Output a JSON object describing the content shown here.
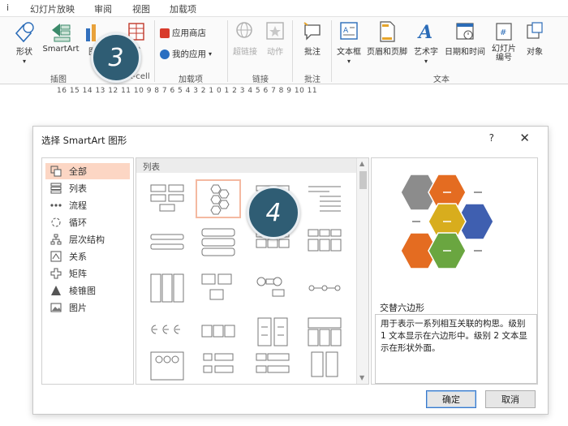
{
  "ribbon": {
    "tabs": [
      "i",
      "幻灯片放映",
      "审阅",
      "视图",
      "加载项"
    ],
    "buttons": {
      "shape": "形状",
      "smartart": "SmartArt",
      "chart": "图",
      "thinkcell": "te",
      "appstore": "应用商店",
      "myapps": "我的应用",
      "hyperlink": "超链接",
      "action": "动作",
      "comment": "批注",
      "textbox": "文本框",
      "headerfooter": "页眉和页脚",
      "wordart": "艺术字",
      "datetime": "日期和时间",
      "slidenumber": "幻灯片\n编号",
      "object": "对象"
    },
    "groups": {
      "illustrations": "插图",
      "thinkcell": "k-cell",
      "addins": "加载项",
      "links": "链接",
      "comments": "批注",
      "text": "文本"
    },
    "ruler": "16 15 14 13 12 11 10 9 8 7 6 5 4 3 2 1 0 1 2 3 4 5 6 7 8 9 10 11"
  },
  "callouts": {
    "step3": "3",
    "step4": "4"
  },
  "dialog": {
    "title": "选择 SmartArt 图形",
    "help": "?",
    "close": "✕",
    "categories": [
      {
        "label": "全部",
        "icon": "all-icon"
      },
      {
        "label": "列表",
        "icon": "list-icon"
      },
      {
        "label": "流程",
        "icon": "process-icon"
      },
      {
        "label": "循环",
        "icon": "cycle-icon"
      },
      {
        "label": "层次结构",
        "icon": "hierarchy-icon"
      },
      {
        "label": "关系",
        "icon": "relationship-icon"
      },
      {
        "label": "矩阵",
        "icon": "matrix-icon"
      },
      {
        "label": "棱锥图",
        "icon": "pyramid-icon"
      },
      {
        "label": "图片",
        "icon": "picture-icon"
      }
    ],
    "selected_category": "全部",
    "gallery_heading": "列表",
    "selected_layout_name": "交替六边形",
    "selected_layout_desc": "用于表示一系列相互关联的构思。级别 1 文本显示在六边形中。级别 2 文本显示在形状外面。",
    "ok": "确定",
    "cancel": "取消"
  },
  "colors": {
    "accent_orange": "#e46c21",
    "hex_gray": "#8c8c8c",
    "hex_yellow": "#d8ad1d",
    "hex_blue": "#3f5fb0",
    "hex_green": "#6aa640",
    "callout": "#2f5d74",
    "selected_bg": "#fcd6c4"
  }
}
